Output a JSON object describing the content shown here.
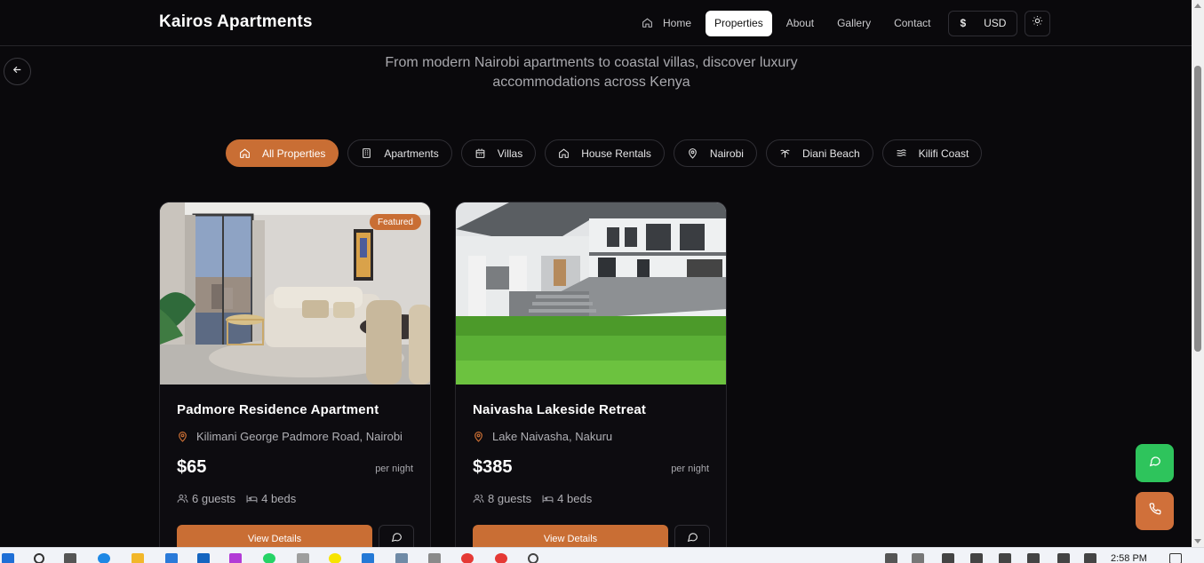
{
  "header": {
    "brand": "Kairos Apartments",
    "nav": [
      {
        "label": "Home",
        "icon": "home-icon"
      },
      {
        "label": "Properties",
        "active": true
      },
      {
        "label": "About"
      },
      {
        "label": "Gallery"
      },
      {
        "label": "Contact"
      }
    ],
    "currency": {
      "symbol": "$",
      "code": "USD"
    },
    "theme_icon": "sun-icon"
  },
  "hero": {
    "subtitle": "From modern Nairobi apartments to coastal villas, discover luxury accommodations across Kenya"
  },
  "filters": [
    {
      "label": "All Properties",
      "icon": "home-icon",
      "active": true
    },
    {
      "label": "Apartments",
      "icon": "building-icon"
    },
    {
      "label": "Villas",
      "icon": "villa-icon"
    },
    {
      "label": "House Rentals",
      "icon": "house-icon"
    },
    {
      "label": "Nairobi",
      "icon": "map-pin-icon"
    },
    {
      "label": "Diani Beach",
      "icon": "palm-tree-icon"
    },
    {
      "label": "Kilifi Coast",
      "icon": "waves-icon"
    }
  ],
  "properties": [
    {
      "badge": "Featured",
      "title": "Padmore Residence Apartment",
      "location": "Kilimani George Padmore Road, Nairobi",
      "price": "$65",
      "per": "per night",
      "guests": "6 guests",
      "beds": "4 beds",
      "button": "View Details"
    },
    {
      "title": "Naivasha Lakeside Retreat",
      "location": "Lake Naivasha, Nakuru",
      "price": "$385",
      "per": "per night",
      "guests": "8 guests",
      "beds": "4 beds",
      "button": "View Details"
    }
  ],
  "floating": {
    "whatsapp_icon": "message-icon",
    "call_icon": "phone-icon"
  },
  "taskbar": {
    "clock": "2:58 PM"
  },
  "colors": {
    "accent": "#c96e34",
    "whatsapp": "#2ec45c",
    "background": "#0a090c"
  }
}
